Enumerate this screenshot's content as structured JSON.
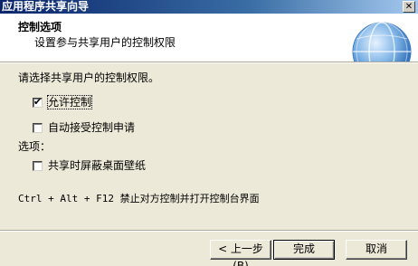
{
  "window": {
    "title": "应用程序共享向导",
    "close_glyph": "✕"
  },
  "header": {
    "title": "控制选项",
    "subtitle": "设置参与共享用户的控制权限"
  },
  "main": {
    "prompt": "请选择共享用户的控制权限。",
    "allow_control": {
      "label": "允许控制",
      "checked": true
    },
    "auto_accept": {
      "label": "自动接受控制申请",
      "checked": false
    },
    "options_heading": "选项：",
    "hide_wallpaper": {
      "label": "共享时屏蔽桌面壁纸",
      "checked": false
    },
    "hotkey_hint": "Ctrl + Alt + F12 禁止对方控制并打开控制台界面"
  },
  "buttons": {
    "back": "< 上一步(B)",
    "finish": "完成",
    "cancel": "取消"
  },
  "colors": {
    "titlebar_start": "#0a246a",
    "titlebar_end": "#a6caf0",
    "dialog_bg": "#ece9d8"
  },
  "icons": {
    "globe": "globe-icon",
    "check": "✔"
  }
}
